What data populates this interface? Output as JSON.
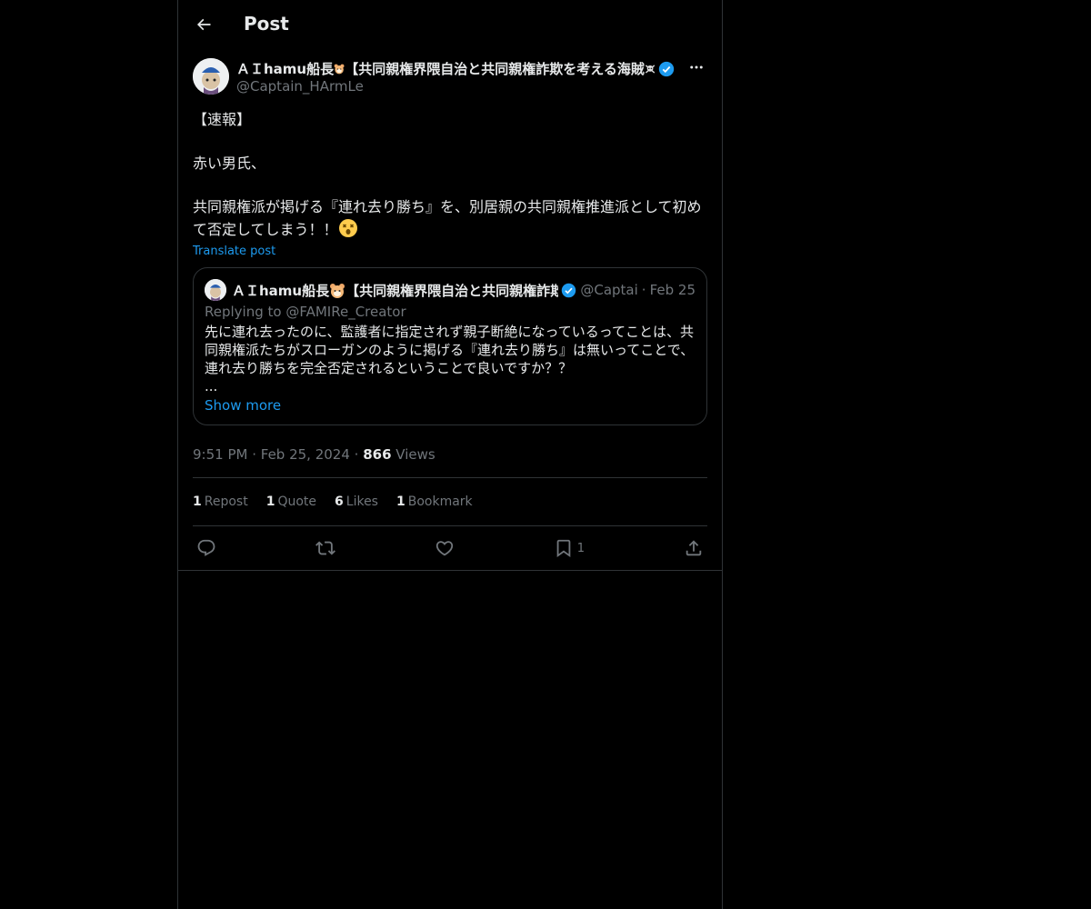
{
  "header": {
    "title": "Post"
  },
  "author": {
    "name": "ＡＩhamu船長",
    "name_suffix": "【共同親権界隈自治と共同親権詐欺を考える海賊",
    "handle": "@Captain_HArmLe"
  },
  "tweet": {
    "line1": "【速報】",
    "line2": "赤い男氏、",
    "line3": "共同親権派が掲げる『連れ去り勝ち』を、別居親の共同親権推進派として初めて否定してしまう！！",
    "translate_label": "Translate post"
  },
  "quote": {
    "name": "ＡＩhamu船長",
    "name_suffix": "【共同親権界隈自治と共同親権詐欺",
    "handle": "@Captai",
    "date": "Feb 25",
    "replying_prefix": "Replying to ",
    "replying_to": "@FAMIRe_Creator",
    "text": "先に連れ去ったのに、監護者に指定されず親子断絶になっているってことは、共同親権派たちがスローガンのように掲げる『連れ去り勝ち』は無いってことで、連れ去り勝ちを完全否定されるということで良いですか？？\n...",
    "show_more": "Show more"
  },
  "meta": {
    "time": "9:51 PM",
    "date": "Feb 25, 2024",
    "views_count": "866",
    "views_label": "Views"
  },
  "stats": {
    "reposts_count": "1",
    "reposts_label": "Repost",
    "quotes_count": "1",
    "quotes_label": "Quote",
    "likes_count": "6",
    "likes_label": "Likes",
    "bookmarks_count": "1",
    "bookmarks_label": "Bookmark"
  },
  "actions": {
    "bookmark_count": "1"
  },
  "colors": {
    "background": "#000000",
    "text": "#e7e9ea",
    "muted": "#71767b",
    "accent": "#1d9bf0",
    "border": "#2f3336"
  },
  "icons": [
    "back-arrow-icon",
    "verified-badge-icon",
    "hamster-emoji-icon",
    "skull-crossbones-icon",
    "more-icon",
    "astonished-emoji-icon",
    "reply-icon",
    "repost-icon",
    "like-icon",
    "bookmark-icon",
    "share-icon"
  ]
}
